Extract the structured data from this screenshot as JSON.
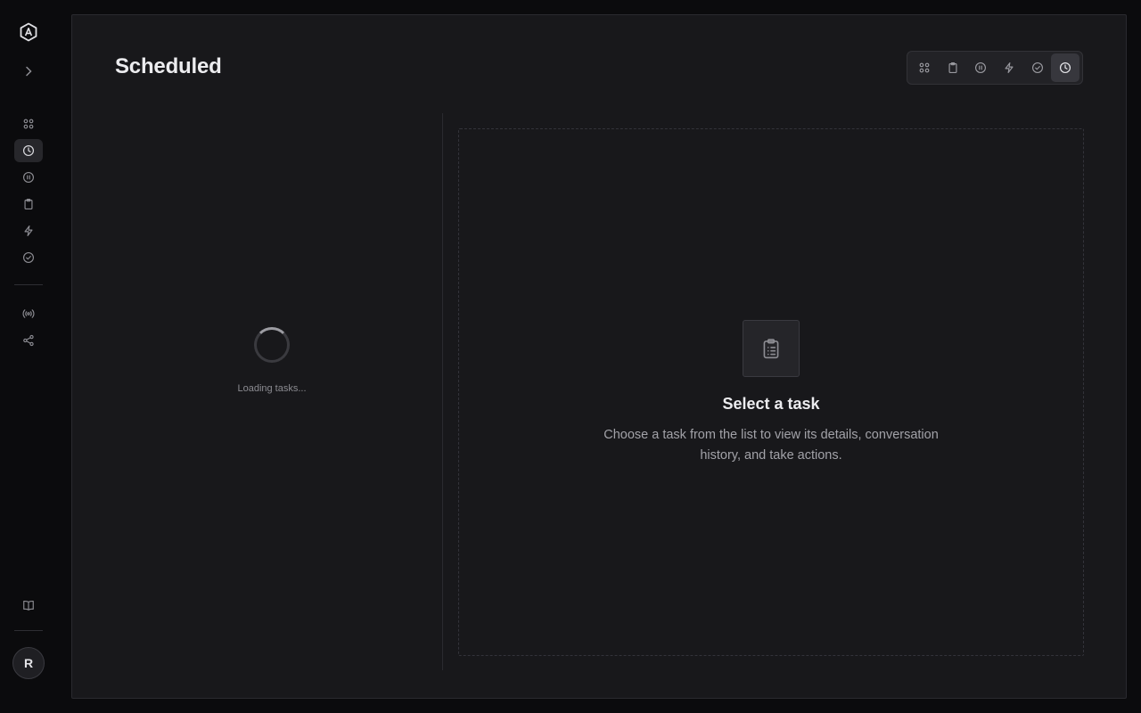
{
  "sidebar": {
    "logo_icon": "hexagon-a-logo",
    "expand_icon": "chevron-right-icon",
    "nav_items": [
      {
        "icon": "grid-icon",
        "label": "All"
      },
      {
        "icon": "clock-icon",
        "label": "Scheduled",
        "active": true
      },
      {
        "icon": "pause-circle-icon",
        "label": "Paused"
      },
      {
        "icon": "clipboard-icon",
        "label": "Tasks"
      },
      {
        "icon": "bolt-icon",
        "label": "Running"
      },
      {
        "icon": "check-circle-icon",
        "label": "Completed"
      }
    ],
    "secondary_items": [
      {
        "icon": "broadcast-icon"
      },
      {
        "icon": "share-nodes-icon"
      }
    ],
    "docs_icon": "book-icon",
    "avatar_initial": "R"
  },
  "page": {
    "title": "Scheduled"
  },
  "view_switcher": {
    "items": [
      {
        "icon": "grid-icon"
      },
      {
        "icon": "clipboard-icon"
      },
      {
        "icon": "pause-circle-icon"
      },
      {
        "icon": "bolt-icon"
      },
      {
        "icon": "check-circle-icon"
      },
      {
        "icon": "clock-icon",
        "active": true
      }
    ]
  },
  "task_list": {
    "loading_text": "Loading tasks..."
  },
  "detail": {
    "empty_icon": "clipboard-list-icon",
    "empty_title": "Select a task",
    "empty_description": "Choose a task from the list to view its details, conversation history, and take actions."
  },
  "colors": {
    "background": "#0b0b0d",
    "panel": "#18181b",
    "active_item": "#27272b"
  }
}
